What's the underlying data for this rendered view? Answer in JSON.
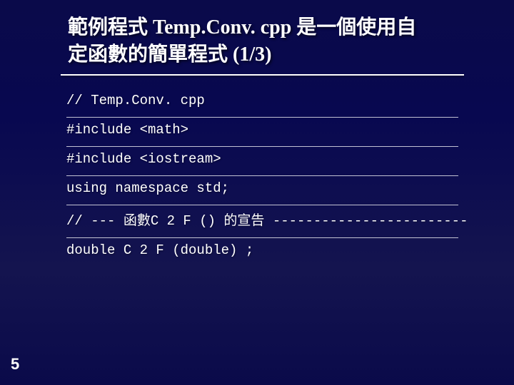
{
  "title": {
    "line1_part1": "範例程式 ",
    "line1_part2": "Temp.Conv. cpp ",
    "line1_part3": "是一個使用自",
    "line2_part1": "定函數的簡單程式 ",
    "line2_part2": "(1/3)"
  },
  "code": [
    "// Temp.Conv. cpp",
    "#include <math>",
    "#include <iostream>",
    "using namespace std;",
    "// --- 函數C 2 F () 的宣告 ------------------------",
    "double C 2 F (double) ;"
  ],
  "page_number": "5"
}
